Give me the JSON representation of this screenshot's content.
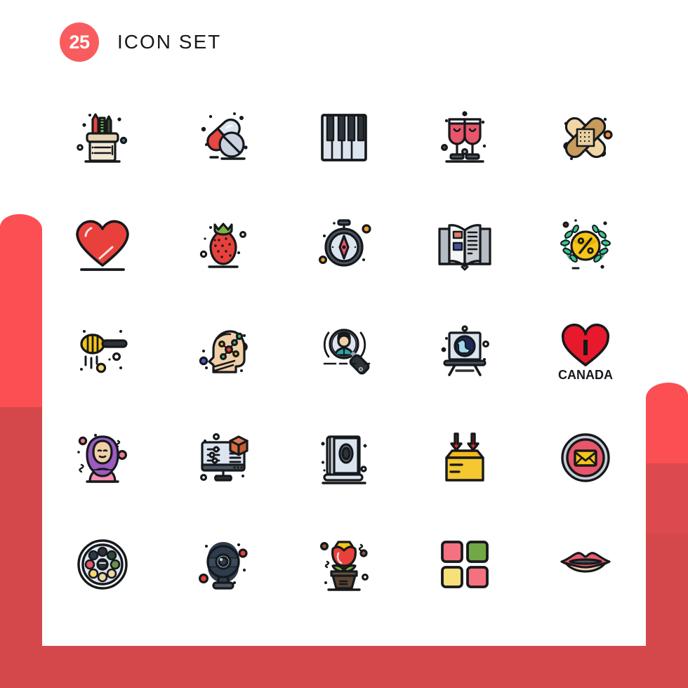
{
  "page": {
    "background_color": "#ffffff",
    "accent_color": "#f95c5e",
    "accent_dark_color": "#d4484b",
    "stroke_color": "#16191c"
  },
  "header": {
    "count": "25",
    "title": "ICON SET"
  },
  "grid": {
    "columns": 5,
    "rows": 5,
    "total": 25,
    "icons": [
      {
        "name": "pencil-holder-icon",
        "label": "Pencil Holder"
      },
      {
        "name": "pills-icon",
        "label": "Pills"
      },
      {
        "name": "piano-keys-icon",
        "label": "Piano"
      },
      {
        "name": "champagne-glasses-icon",
        "label": "Cheers"
      },
      {
        "name": "bandages-icon",
        "label": "Bandages"
      },
      {
        "name": "heart-icon",
        "label": "Heart"
      },
      {
        "name": "strawberry-icon",
        "label": "Strawberry"
      },
      {
        "name": "compass-icon",
        "label": "Compass"
      },
      {
        "name": "open-book-icon",
        "label": "Open Book"
      },
      {
        "name": "discount-wreath-icon",
        "label": "Discount Badge"
      },
      {
        "name": "honey-dipper-icon",
        "label": "Honey Dipper"
      },
      {
        "name": "brain-network-icon",
        "label": "Mind Network"
      },
      {
        "name": "candidate-search-icon",
        "label": "Candidate Search"
      },
      {
        "name": "xray-display-icon",
        "label": "X-Ray Display"
      },
      {
        "name": "i-love-canada-icon",
        "label": "I Love Canada"
      },
      {
        "name": "hijab-woman-icon",
        "label": "Hijab Woman"
      },
      {
        "name": "3d-modeling-icon",
        "label": "3D Modeling"
      },
      {
        "name": "quran-book-icon",
        "label": "Holy Book"
      },
      {
        "name": "package-box-icon",
        "label": "Package Inbox"
      },
      {
        "name": "email-button-icon",
        "label": "Email"
      },
      {
        "name": "lens-wheel-icon",
        "label": "Lens Wheel"
      },
      {
        "name": "webcam-icon",
        "label": "Webcam"
      },
      {
        "name": "potted-flower-icon",
        "label": "Potted Flower"
      },
      {
        "name": "app-grid-icon",
        "label": "App Grid"
      },
      {
        "name": "lips-icon",
        "label": "Lips"
      }
    ]
  },
  "icon_text": {
    "canada_heart_letter": "I",
    "canada_word": "CANADA",
    "discount_symbol": "%"
  }
}
